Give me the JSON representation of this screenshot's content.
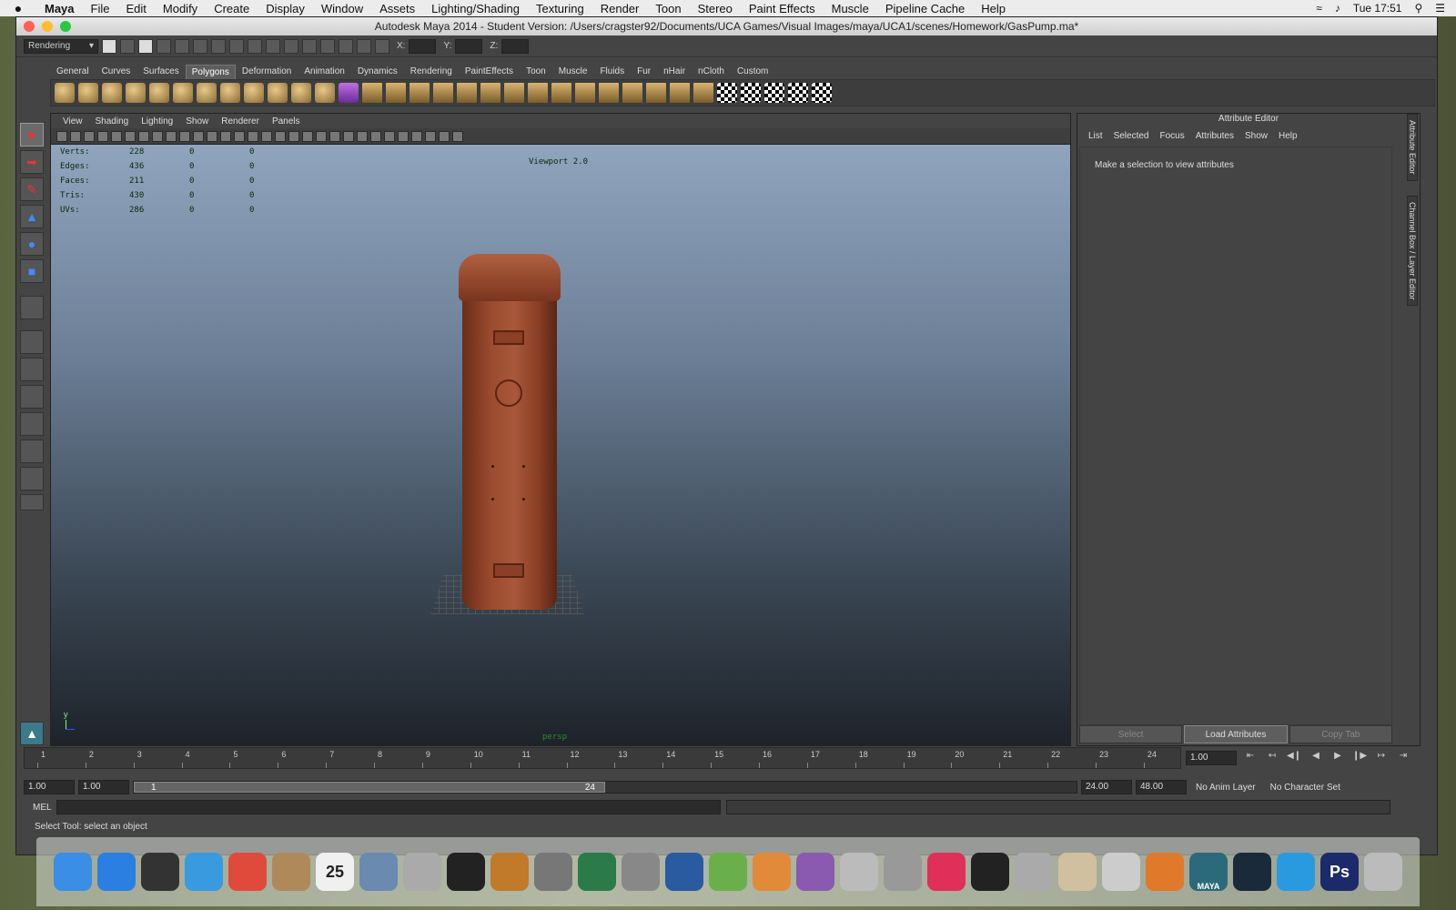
{
  "menubar": {
    "apple": "",
    "items": [
      "Maya",
      "File",
      "Edit",
      "Modify",
      "Create",
      "Display",
      "Window",
      "Assets",
      "Lighting/Shading",
      "Texturing",
      "Render",
      "Toon",
      "Stereo",
      "Paint Effects",
      "Muscle",
      "Pipeline Cache",
      "Help"
    ],
    "clock": "Tue 17:51"
  },
  "window": {
    "title": "Autodesk Maya 2014 - Student Version: /Users/cragster92/Documents/UCA Games/Visual Images/maya/UCA1/scenes/Homework/GasPump.ma*"
  },
  "statusline": {
    "menuset": "Rendering",
    "x_label": "X:",
    "y_label": "Y:",
    "z_label": "Z:"
  },
  "shelf": {
    "tabs": [
      "General",
      "Curves",
      "Surfaces",
      "Polygons",
      "Deformation",
      "Animation",
      "Dynamics",
      "Rendering",
      "PaintEffects",
      "Toon",
      "Muscle",
      "Fluids",
      "Fur",
      "nHair",
      "nCloth",
      "Custom"
    ],
    "active_tab": "Polygons"
  },
  "viewport": {
    "menu": [
      "View",
      "Shading",
      "Lighting",
      "Show",
      "Renderer",
      "Panels"
    ],
    "title": "Viewport 2.0",
    "camera": "persp",
    "hud": [
      {
        "label": "Verts:",
        "a": "228",
        "b": "0",
        "c": "0"
      },
      {
        "label": "Edges:",
        "a": "436",
        "b": "0",
        "c": "0"
      },
      {
        "label": "Faces:",
        "a": "211",
        "b": "0",
        "c": "0"
      },
      {
        "label": "Tris:",
        "a": "430",
        "b": "0",
        "c": "0"
      },
      {
        "label": "UVs:",
        "a": "286",
        "b": "0",
        "c": "0"
      }
    ],
    "axis_label": "y"
  },
  "attribute_editor": {
    "title": "Attribute Editor",
    "menu": [
      "List",
      "Selected",
      "Focus",
      "Attributes",
      "Show",
      "Help"
    ],
    "message": "Make a selection to view attributes",
    "buttons": {
      "select": "Select",
      "load": "Load Attributes",
      "copy": "Copy Tab"
    },
    "side_tabs": [
      "Attribute Editor",
      "Channel Box / Layer Editor"
    ]
  },
  "timeline": {
    "ticks": [
      "1",
      "2",
      "3",
      "4",
      "5",
      "6",
      "7",
      "8",
      "9",
      "10",
      "11",
      "12",
      "13",
      "14",
      "15",
      "16",
      "17",
      "18",
      "19",
      "20",
      "21",
      "22",
      "23",
      "24"
    ],
    "current_time": "1.00",
    "range_start": "1.00",
    "playback_start": "1.00",
    "range_bar_start": "1",
    "range_bar_end": "24",
    "playback_end": "24.00",
    "range_end": "48.00",
    "anim_layer": "No Anim Layer",
    "character_set": "No Character Set"
  },
  "command": {
    "mel_label": "MEL",
    "help": "Select Tool: select an object"
  },
  "dock": {
    "items": [
      "Finder",
      "App Store",
      "Dashboard",
      "Safari",
      "Chrome",
      "Contacts",
      "Calendar",
      "Preview",
      "Disk Utility",
      "iMovie",
      "GarageBand",
      "Photos",
      "Time Machine",
      "System Preferences",
      "Word",
      "Maya Tool",
      "PowerPoint",
      "Edge",
      "Grapher",
      "Network",
      "iTunes",
      "Unity",
      "Installer",
      "Paint",
      "Preview2",
      "iBooks",
      "Maya",
      "Steam",
      "Skype",
      "Photoshop",
      "Trash"
    ],
    "calendar_day": "25",
    "maya_label": "MAYA",
    "ps_label": "Ps"
  }
}
